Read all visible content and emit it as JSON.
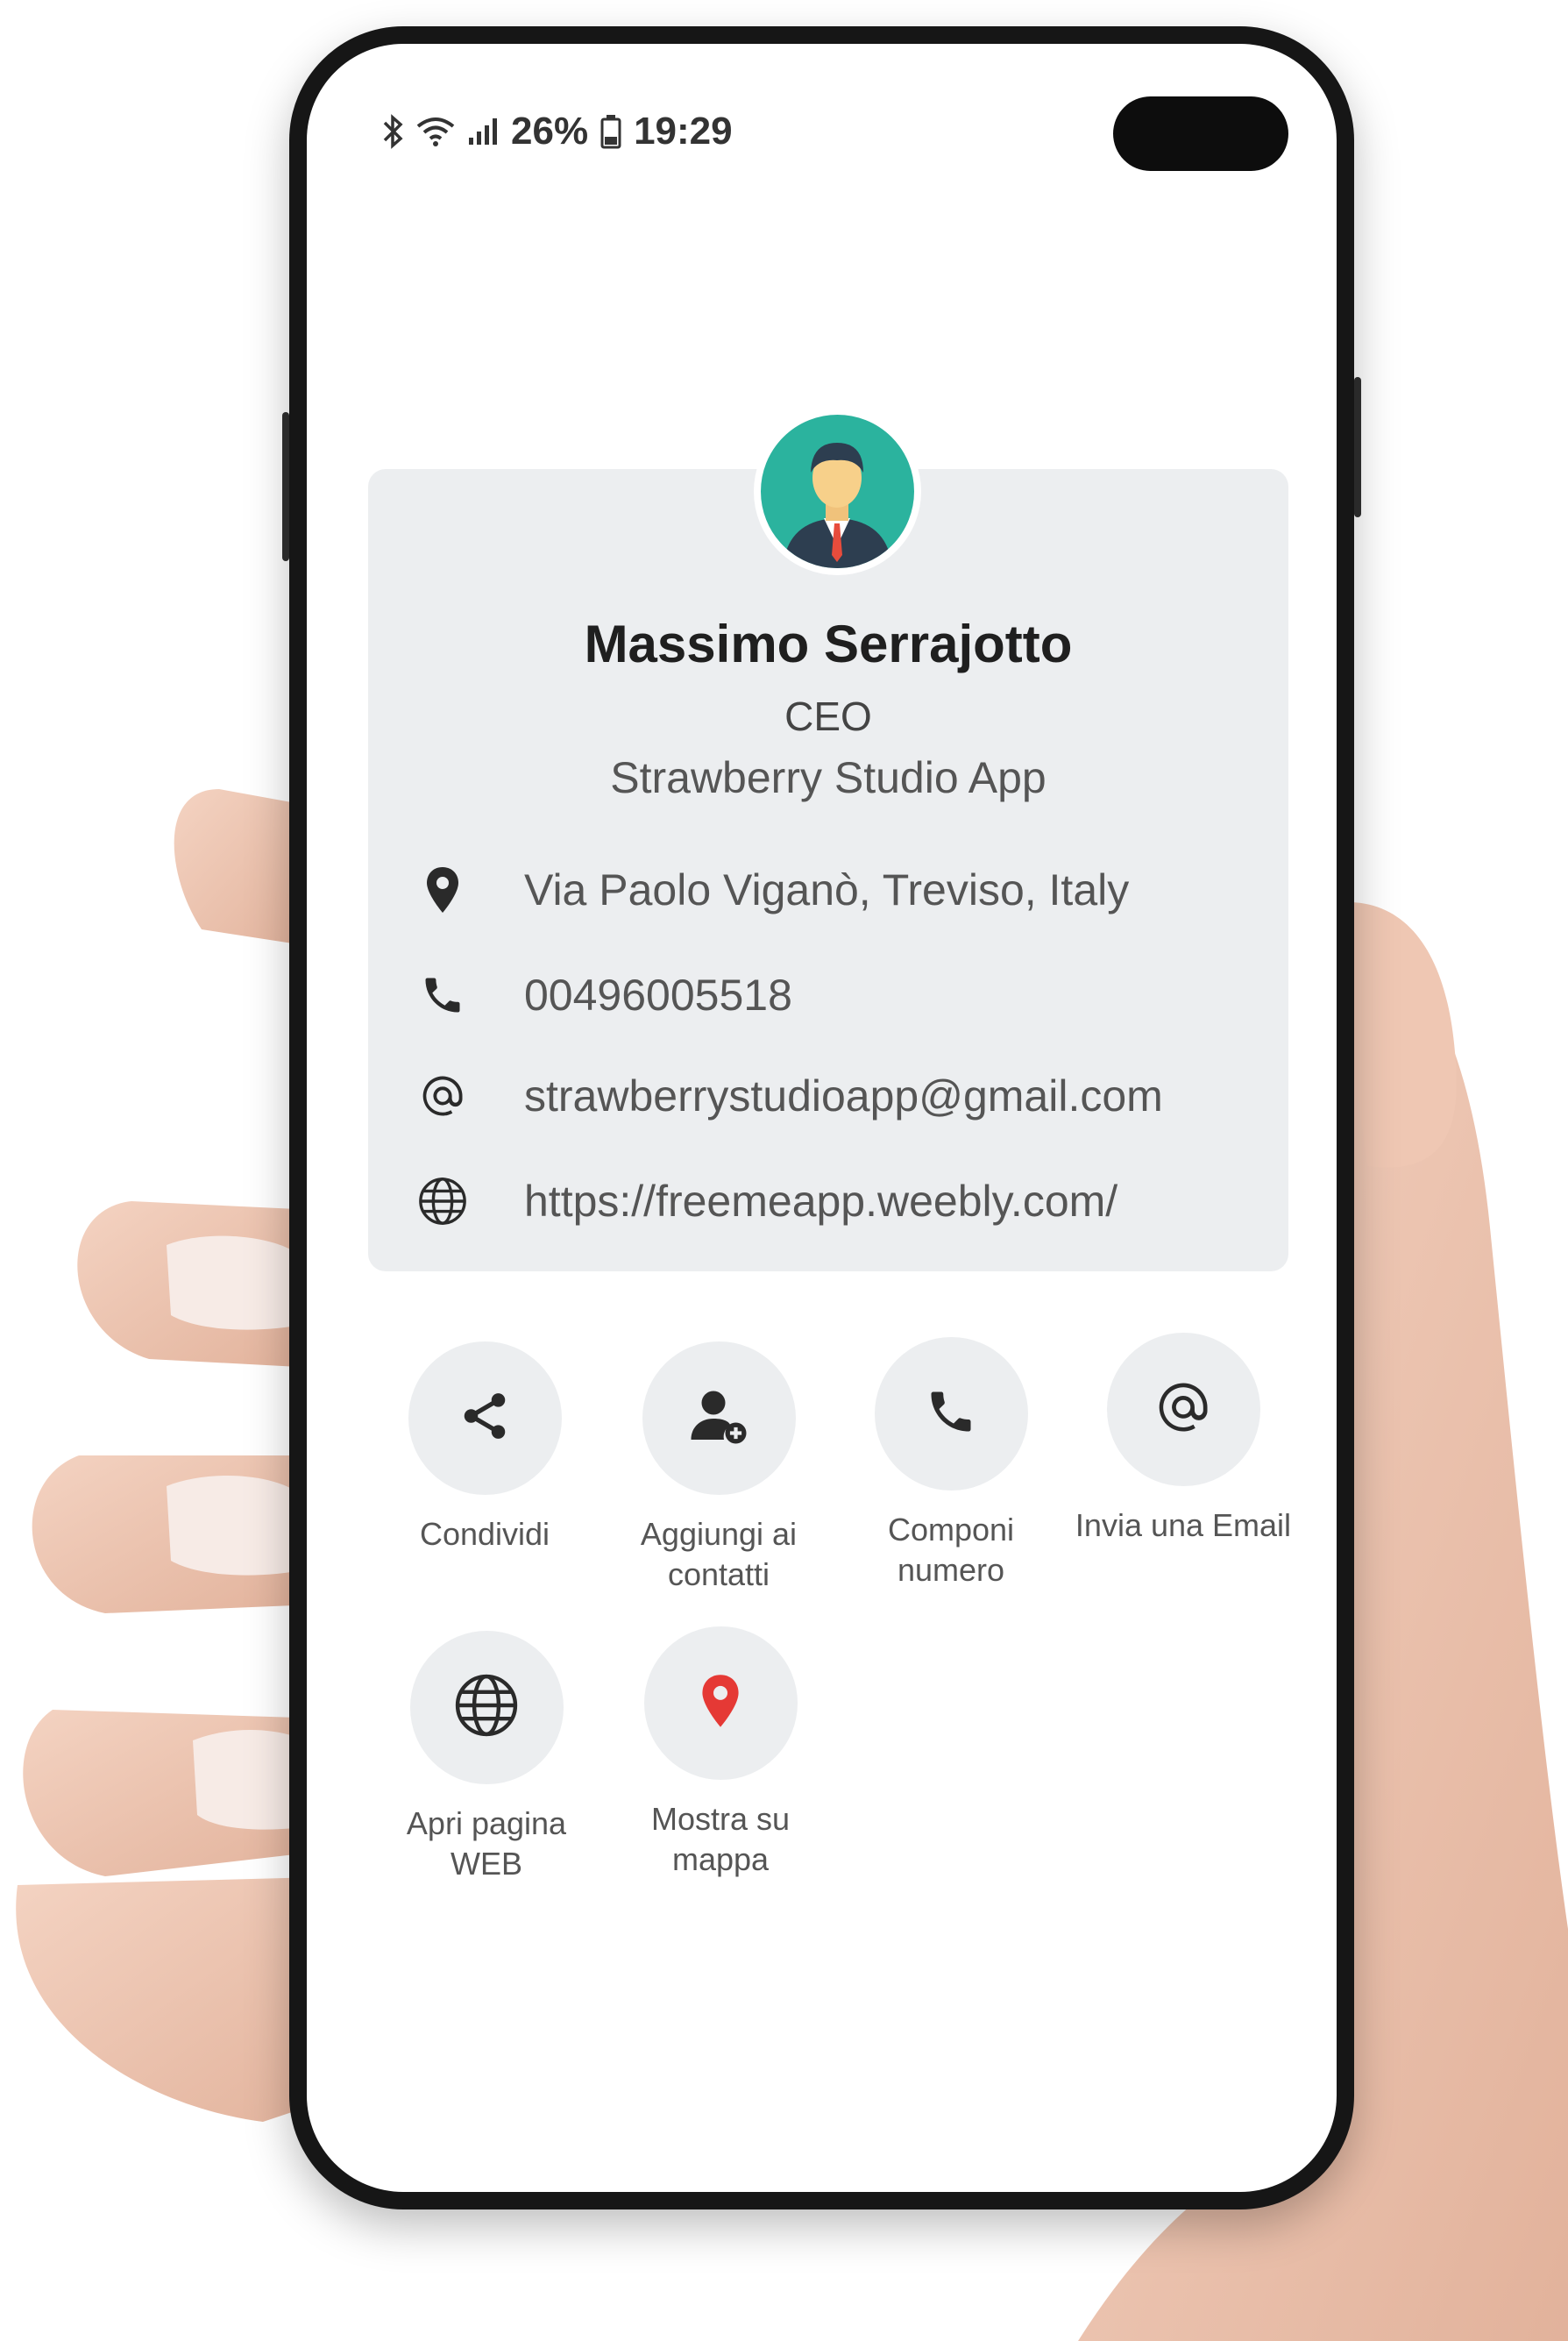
{
  "status_bar": {
    "battery": "26%",
    "time": "19:29"
  },
  "profile": {
    "name": "Massimo Serrajotto",
    "role": "CEO",
    "company": "Strawberry Studio App"
  },
  "contact_info": [
    {
      "icon": "location-pin-icon",
      "value": "Via Paolo Viganò, Treviso, Italy"
    },
    {
      "icon": "phone-icon",
      "value": "00496005518"
    },
    {
      "icon": "at-icon",
      "value": "strawberrystudioapp@gmail.com"
    },
    {
      "icon": "globe-icon",
      "value": "https://freemeapp.weebly.com/"
    }
  ],
  "actions": [
    {
      "icon": "share-icon",
      "label_line1": "Condividi",
      "label_line2": ""
    },
    {
      "icon": "add-contact-icon",
      "label_line1": "Aggiungi ai",
      "label_line2": "contatti"
    },
    {
      "icon": "phone-icon",
      "label_line1": "Componi",
      "label_line2": "numero"
    },
    {
      "icon": "at-icon",
      "label_line1": "Invia una Email",
      "label_line2": ""
    },
    {
      "icon": "globe-icon",
      "label_line1": "Apri pagina",
      "label_line2": "WEB"
    },
    {
      "icon": "map-pin-icon",
      "label_line1": "Mostra su",
      "label_line2": "mappa"
    }
  ],
  "colors": {
    "avatar_bg": "#2bb39e",
    "card_bg": "#eceef0",
    "map_pin": "#e53935"
  }
}
